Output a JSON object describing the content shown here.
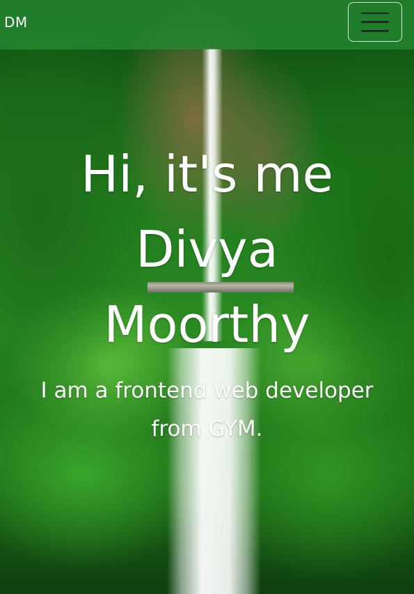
{
  "navbar": {
    "brand": "DM",
    "toggler_icon": "hamburger-menu-icon"
  },
  "hero": {
    "title_line1": "Hi, it's me",
    "title_line2": "Divya",
    "title_line3": "Moorthy",
    "subtitle": "I am a frontend web developer from GYM."
  },
  "background": {
    "subject": "waterfall-with-bridge-in-jungle",
    "colors": {
      "navbar": "#268c32",
      "text": "#ffffff"
    }
  }
}
